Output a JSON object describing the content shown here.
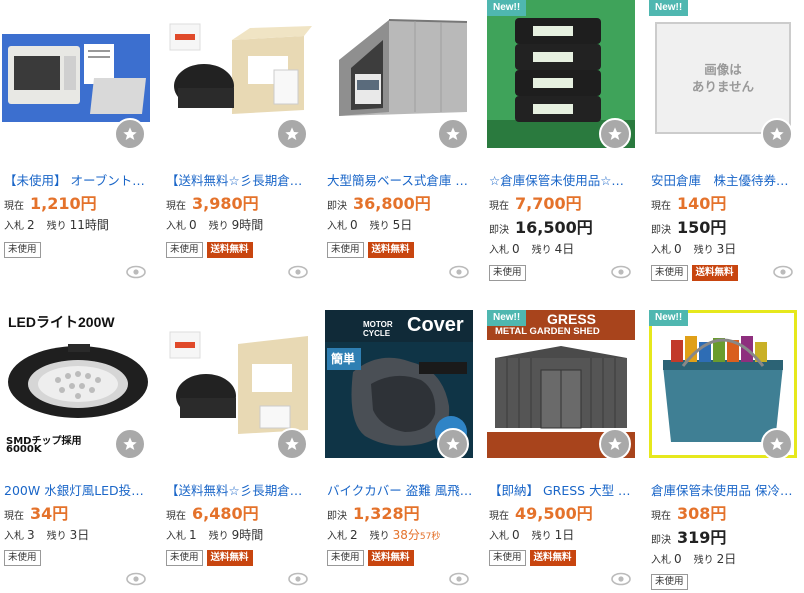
{
  "labels": {
    "current": "現在",
    "buynow": "即決",
    "bids": "入札",
    "remaining": "残り",
    "new_badge": "New!!",
    "tag_unused": "未使用",
    "tag_free_shipping": "送料無料",
    "no_image_line1": "画像は",
    "no_image_line2": "ありません"
  },
  "items": [
    {
      "title": "【未使用】 オーブント…",
      "price_current": "1,210円",
      "bids": "2",
      "remaining": "11時間",
      "tags": [
        "未使用"
      ]
    },
    {
      "title": "【送料無料☆彡長期倉庫…",
      "price_current": "3,980円",
      "bids": "0",
      "remaining": "9時間",
      "tags": [
        "未使用",
        "送料無料"
      ]
    },
    {
      "title": "大型簡易ベース式倉庫 …",
      "price_buynow": "36,800円",
      "bids": "0",
      "remaining": "5日",
      "tags": [
        "未使用",
        "送料無料"
      ]
    },
    {
      "title": "☆倉庫保管未使用品☆　…",
      "price_current": "7,700円",
      "price_buynow": "16,500円",
      "bids": "0",
      "remaining": "4日",
      "tags": [
        "未使用"
      ],
      "new": true
    },
    {
      "title": "安田倉庫　株主優待券●…",
      "price_current": "140円",
      "price_buynow": "150円",
      "bids": "0",
      "remaining": "3日",
      "tags": [
        "未使用",
        "送料無料"
      ],
      "new": true
    },
    {
      "title": "200W 水銀灯風LED投光…",
      "price_current": "34円",
      "bids": "3",
      "remaining": "3日",
      "tags": [
        "未使用"
      ],
      "img_text": "LEDライト200W",
      "img_text2": "SMDチップ採用",
      "img_text3": "6000K"
    },
    {
      "title": "【送料無料☆彡長期倉庫…",
      "price_current": "6,480円",
      "bids": "1",
      "remaining": "9時間",
      "tags": [
        "未使用",
        "送料無料"
      ]
    },
    {
      "title": "バイクカバー 盗難 風飛…",
      "price_buynow": "1,328円",
      "bids": "2",
      "remaining": "38分",
      "remaining_sec": "57秒",
      "tags": [
        "未使用",
        "送料無料"
      ],
      "img_text": "MOTOR CYCLE",
      "img_text2": "Cover",
      "img_text3": "簡単"
    },
    {
      "title": "【即納】 GRESS 大型 …",
      "price_current": "49,500円",
      "bids": "0",
      "remaining": "1日",
      "tags": [
        "未使用",
        "送料無料"
      ],
      "new": true,
      "img_text": "GRESS",
      "img_text2": "METAL GARDEN SHED"
    },
    {
      "title": "倉庫保管未使用品 保冷…",
      "price_current": "308円",
      "price_buynow": "319円",
      "bids": "0",
      "remaining": "2日",
      "tags": [
        "未使用"
      ],
      "new": true
    }
  ]
}
